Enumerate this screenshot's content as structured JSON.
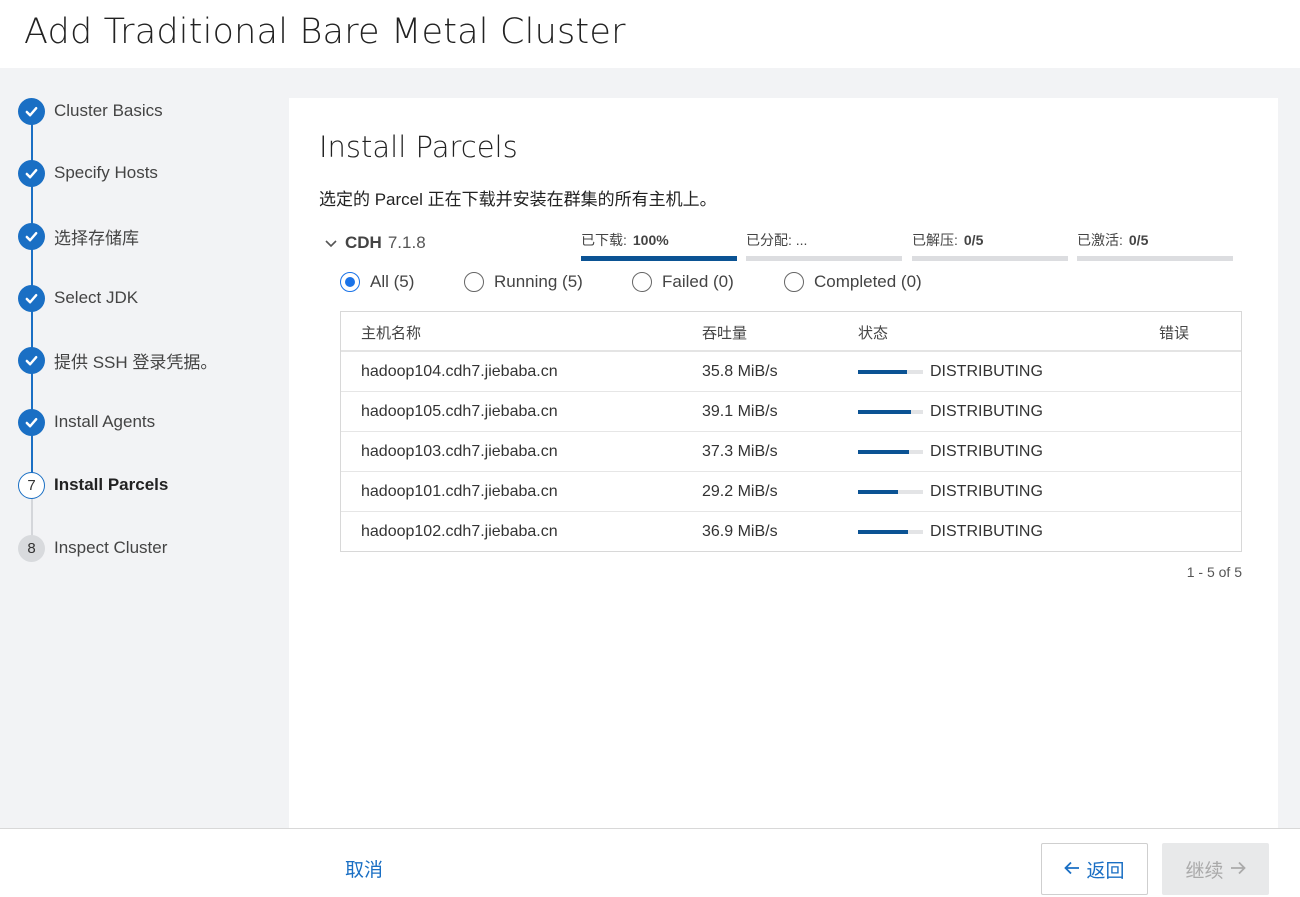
{
  "page": {
    "title": "Add Traditional Bare Metal Cluster"
  },
  "steps": [
    {
      "label": "Cluster Basics",
      "state": "done",
      "icon": "check-icon"
    },
    {
      "label": "Specify Hosts",
      "state": "done",
      "icon": "check-icon"
    },
    {
      "label": "选择存储库",
      "state": "done",
      "icon": "check-icon"
    },
    {
      "label": "Select JDK",
      "state": "done",
      "icon": "check-icon"
    },
    {
      "label": "提供 SSH 登录凭据。",
      "state": "done",
      "icon": "check-icon"
    },
    {
      "label": "Install Agents",
      "state": "done",
      "icon": "check-icon"
    },
    {
      "label": "Install Parcels",
      "state": "current",
      "number": "7"
    },
    {
      "label": "Inspect Cluster",
      "state": "pending",
      "number": "8"
    }
  ],
  "panel": {
    "title": "Install Parcels",
    "description": "选定的 Parcel 正在下载并安装在群集的所有主机上。",
    "parcel": {
      "name": "CDH",
      "version": "7.1.8",
      "toggle_icon": "chevron-down-icon"
    },
    "progress": [
      {
        "label": "已下载:",
        "value": "100%",
        "fraction": 1.0
      },
      {
        "label": "已分配: ...",
        "value": "",
        "fraction": 0
      },
      {
        "label": "已解压:",
        "value": "0/5",
        "fraction": 0
      },
      {
        "label": "已激活:",
        "value": "0/5",
        "fraction": 0
      }
    ],
    "filters": [
      {
        "label": "All (5)",
        "selected": true
      },
      {
        "label": "Running (5)",
        "selected": false
      },
      {
        "label": "Failed (0)",
        "selected": false
      },
      {
        "label": "Completed (0)",
        "selected": false
      }
    ],
    "table": {
      "columns": [
        "主机名称",
        "吞吐量",
        "状态",
        "错误"
      ],
      "rows": [
        {
          "host": "hadoop104.cdh7.jiebaba.cn",
          "throughput": "35.8 MiB/s",
          "progress": 0.75,
          "status": "DISTRIBUTING",
          "error": ""
        },
        {
          "host": "hadoop105.cdh7.jiebaba.cn",
          "throughput": "39.1 MiB/s",
          "progress": 0.82,
          "status": "DISTRIBUTING",
          "error": ""
        },
        {
          "host": "hadoop103.cdh7.jiebaba.cn",
          "throughput": "37.3 MiB/s",
          "progress": 0.78,
          "status": "DISTRIBUTING",
          "error": ""
        },
        {
          "host": "hadoop101.cdh7.jiebaba.cn",
          "throughput": "29.2 MiB/s",
          "progress": 0.62,
          "status": "DISTRIBUTING",
          "error": ""
        },
        {
          "host": "hadoop102.cdh7.jiebaba.cn",
          "throughput": "36.9 MiB/s",
          "progress": 0.77,
          "status": "DISTRIBUTING",
          "error": ""
        }
      ]
    },
    "pager": "1 - 5 of 5"
  },
  "footer": {
    "cancel_label": "取消",
    "back_label": "返回",
    "next_label": "继续"
  },
  "colors": {
    "accent": "#1a6fc4",
    "bar": "#0b5394",
    "sidebar_bg": "#f2f3f5"
  }
}
